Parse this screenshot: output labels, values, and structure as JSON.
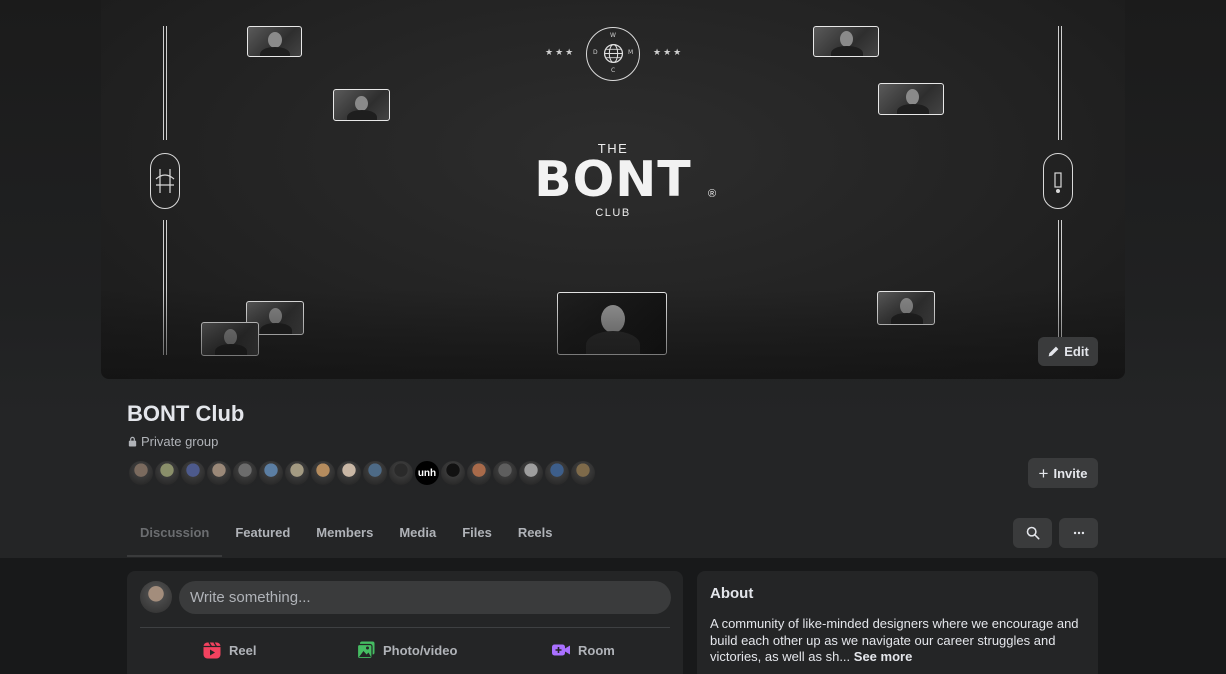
{
  "cover": {
    "logo_the": "THE",
    "logo_main": "BONT",
    "logo_reg": "®",
    "logo_club": "CLUB",
    "emblem_letters": [
      "W",
      "D",
      "M",
      "C"
    ],
    "stars": "★★★",
    "edit_label": "Edit"
  },
  "group": {
    "name": "BONT Club",
    "privacy": "Private group",
    "invite_label": "Invite",
    "member_avatar_colors": [
      "#7a6a5e",
      "#8a8f6a",
      "#4d5a8c",
      "#9a8878",
      "#6c6c6c",
      "#5b7ea3",
      "#a39a82",
      "#b58c5e",
      "#c9b7a5",
      "#4d6a86",
      "#2a2a2a",
      "#8c8c8c",
      "#111111",
      "#a86a4a",
      "#5e5e5e",
      "#9e9e9e",
      "#3d5e8a",
      "#7e6a4a"
    ],
    "avatar_center_text": "unh"
  },
  "tabs": [
    {
      "label": "Discussion",
      "active": true
    },
    {
      "label": "Featured",
      "active": false
    },
    {
      "label": "Members",
      "active": false
    },
    {
      "label": "Media",
      "active": false
    },
    {
      "label": "Files",
      "active": false
    },
    {
      "label": "Reels",
      "active": false
    }
  ],
  "composer": {
    "placeholder": "Write something...",
    "actions": [
      {
        "label": "Reel",
        "icon": "reel-icon",
        "color": "#f3425f"
      },
      {
        "label": "Photo/video",
        "icon": "photo-video-icon",
        "color": "#45bd62"
      },
      {
        "label": "Room",
        "icon": "room-video-icon",
        "color": "#a970ff"
      }
    ]
  },
  "about": {
    "title": "About",
    "text": "A community of like-minded designers where we encourage and build each other up as we navigate our career struggles and victories, as well as sh...",
    "see_more": "See more"
  }
}
